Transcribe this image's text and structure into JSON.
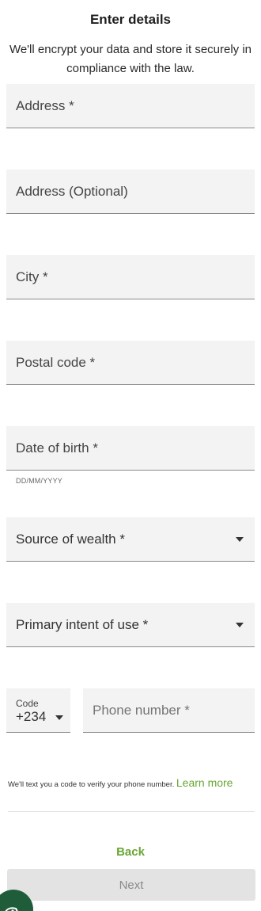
{
  "header": {
    "title": "Enter details",
    "subtitle": "We'll encrypt your data and store it securely in compliance with the law."
  },
  "form": {
    "address": {
      "placeholder": "Address *"
    },
    "address2": {
      "placeholder": "Address (Optional)"
    },
    "city": {
      "placeholder": "City *"
    },
    "postal_code": {
      "placeholder": "Postal code *"
    },
    "dob": {
      "placeholder": "Date of birth *",
      "hint": "DD/MM/YYYY"
    },
    "source_of_wealth": {
      "label": "Source of wealth *"
    },
    "primary_intent": {
      "label": "Primary intent of use *"
    },
    "phone": {
      "code_label": "Code",
      "code_value": "+234",
      "placeholder": "Phone number *"
    },
    "sms_note": "We'll text you a code to verify your phone number.",
    "learn_more": "Learn more"
  },
  "actions": {
    "back": "Back",
    "next": "Next"
  },
  "colors": {
    "accent_green": "#6aa534",
    "field_bg": "#f3f3f3",
    "chat_bubble": "#1f5d3a"
  },
  "icons": [
    "chevron-down-icon",
    "chat-icon"
  ]
}
